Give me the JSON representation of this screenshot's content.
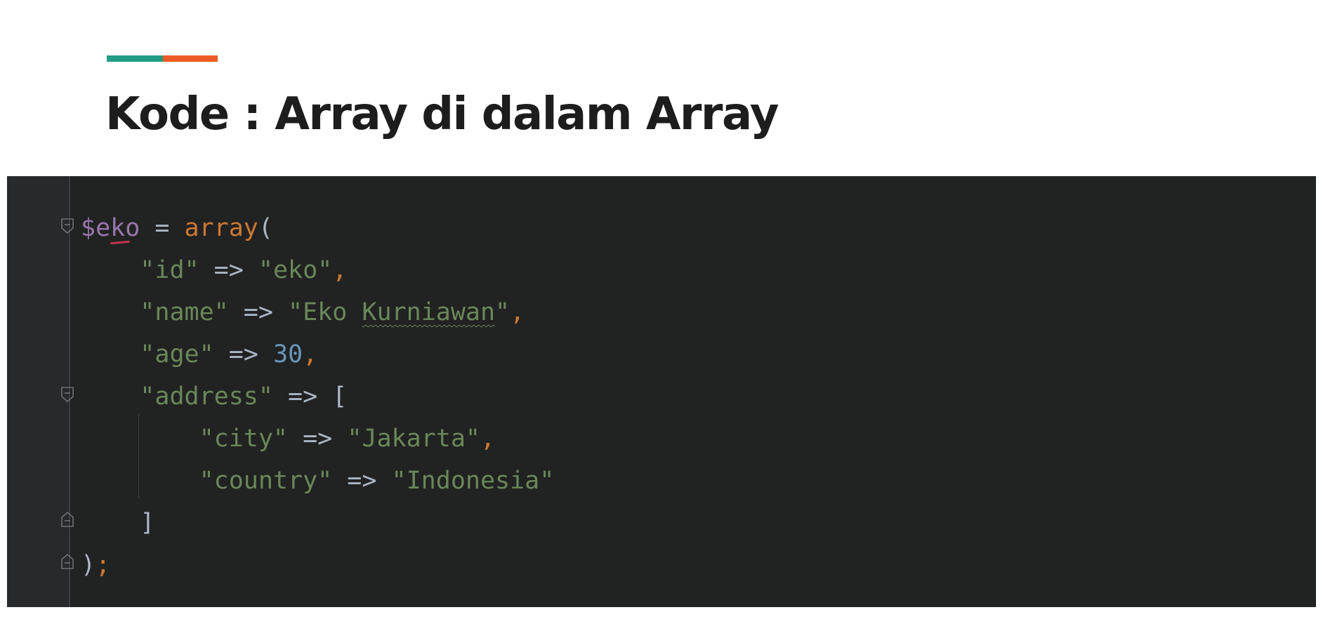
{
  "slide": {
    "title": "Kode : Array di dalam Array",
    "accent_colors": [
      "#1f9c84",
      "#ee5a24"
    ]
  },
  "code": {
    "language": "php",
    "lines": [
      [
        {
          "t": "$eko",
          "c": "var"
        },
        {
          "t": " = ",
          "c": "op"
        },
        {
          "t": "array",
          "c": "kw"
        },
        {
          "t": "(",
          "c": "op"
        }
      ],
      [
        {
          "t": "    ",
          "c": "op"
        },
        {
          "t": "\"id\"",
          "c": "str"
        },
        {
          "t": " => ",
          "c": "op"
        },
        {
          "t": "\"eko\"",
          "c": "str"
        },
        {
          "t": ",",
          "c": "punc"
        }
      ],
      [
        {
          "t": "    ",
          "c": "op"
        },
        {
          "t": "\"name\"",
          "c": "str"
        },
        {
          "t": " => ",
          "c": "op"
        },
        {
          "t": "\"Eko ",
          "c": "str"
        },
        {
          "t": "Kurniawan",
          "c": "str spell"
        },
        {
          "t": "\"",
          "c": "str"
        },
        {
          "t": ",",
          "c": "punc"
        }
      ],
      [
        {
          "t": "    ",
          "c": "op"
        },
        {
          "t": "\"age\"",
          "c": "str"
        },
        {
          "t": " => ",
          "c": "op"
        },
        {
          "t": "30",
          "c": "num"
        },
        {
          "t": ",",
          "c": "punc"
        }
      ],
      [
        {
          "t": "    ",
          "c": "op"
        },
        {
          "t": "\"address\"",
          "c": "str"
        },
        {
          "t": " => [",
          "c": "op"
        }
      ],
      [
        {
          "t": "        ",
          "c": "op"
        },
        {
          "t": "\"city\"",
          "c": "str"
        },
        {
          "t": " => ",
          "c": "op"
        },
        {
          "t": "\"Jakarta\"",
          "c": "str"
        },
        {
          "t": ",",
          "c": "punc"
        }
      ],
      [
        {
          "t": "        ",
          "c": "op"
        },
        {
          "t": "\"country\"",
          "c": "str"
        },
        {
          "t": " => ",
          "c": "op"
        },
        {
          "t": "\"Indonesia\"",
          "c": "str"
        }
      ],
      [
        {
          "t": "    ]",
          "c": "op"
        }
      ],
      [
        {
          "t": ")",
          "c": "op"
        },
        {
          "t": ";",
          "c": "punc"
        }
      ]
    ]
  }
}
